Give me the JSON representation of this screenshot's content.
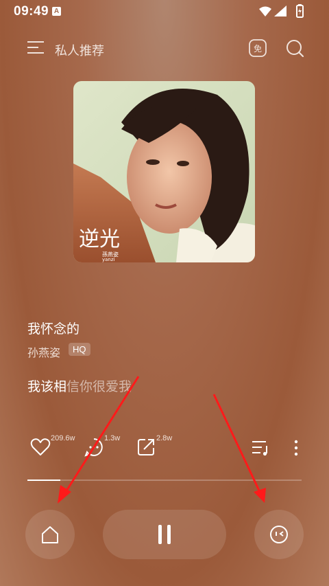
{
  "status_bar": {
    "time": "09:49",
    "notification_badge": "A"
  },
  "header": {
    "title": "私人推荐",
    "free_label": "免"
  },
  "album": {
    "cover_title": "逆光",
    "cover_artist": "孫燕姿",
    "cover_subtitle": "yanzi"
  },
  "song": {
    "title": "我怀念的",
    "artist": "孙燕姿",
    "quality_badge": "HQ"
  },
  "lyrics": {
    "sung": "我该相",
    "unsung": "信你很爱我"
  },
  "actions": {
    "like_count": "209.6w",
    "comment_count": "1.3w",
    "share_count": "2.8w"
  },
  "progress": {
    "played_fraction": 0.12
  },
  "colors": {
    "accent_annotation": "#ff0000",
    "background": "#a6694c"
  }
}
